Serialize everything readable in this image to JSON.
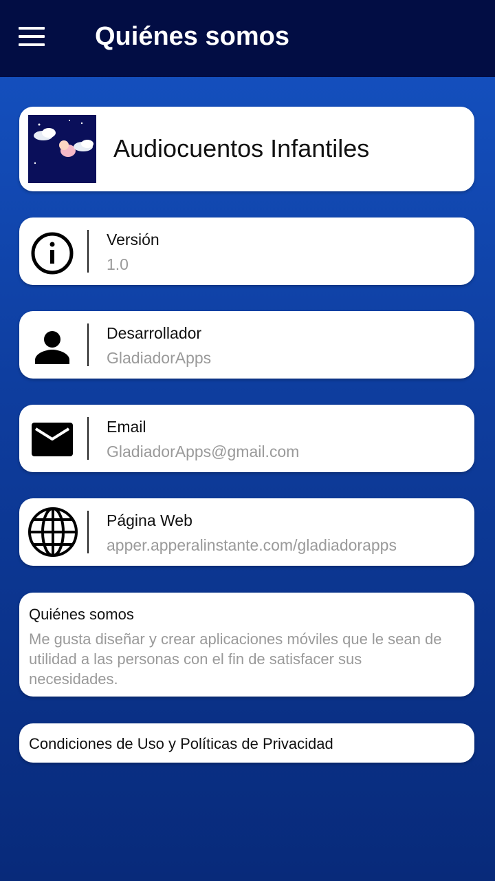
{
  "appbar": {
    "title": "Quiénes somos",
    "menu_icon": "hamburger-menu-icon"
  },
  "header_card": {
    "app_name": "Audiocuentos Infantiles",
    "logo_icon": "moon-sleeping-baby-logo"
  },
  "info_items": [
    {
      "icon": "info-circle-icon",
      "label": "Versión",
      "value": "1.0"
    },
    {
      "icon": "person-icon",
      "label": "Desarrollador",
      "value": "GladiadorApps"
    },
    {
      "icon": "envelope-icon",
      "label": "Email",
      "value": "GladiadorApps@gmail.com"
    },
    {
      "icon": "globe-icon",
      "label": "Página Web",
      "value": "apper.apperalinstante.com/gladiadorapps"
    }
  ],
  "about": {
    "label": "Quiénes somos",
    "text": "Me gusta diseñar y crear aplicaciones móviles que le sean de utilidad a las personas con el fin de satisfacer sus necesidades."
  },
  "terms": {
    "label": "Condiciones de Uso y Políticas de Privacidad"
  },
  "colors": {
    "appbar": "#020d44",
    "background_top": "#1553c4",
    "background_bottom": "#082a7a",
    "card": "#ffffff",
    "secondary_text": "#9a9a9a"
  }
}
